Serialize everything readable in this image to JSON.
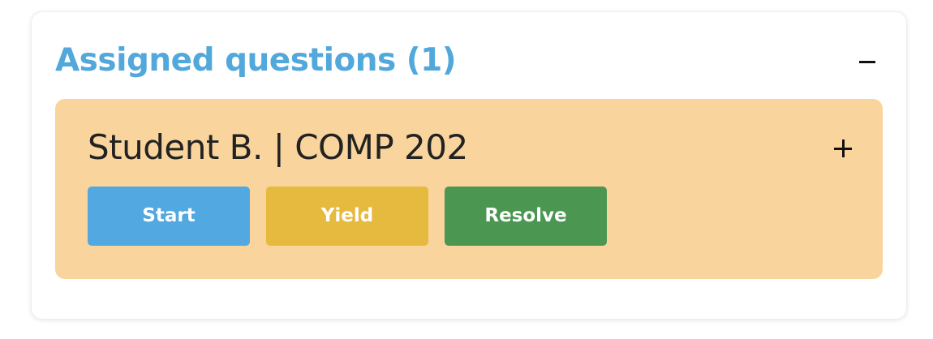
{
  "panel": {
    "title": "Assigned questions (1)",
    "collapse_icon": "minus-icon",
    "title_color": "#52a8db"
  },
  "question": {
    "title": "Student B. | COMP 202",
    "expand_icon": "plus-icon",
    "card_color": "#f9d49d",
    "actions": [
      {
        "label": "Start",
        "color": "#52a8e0"
      },
      {
        "label": "Yield",
        "color": "#e6b93f"
      },
      {
        "label": "Resolve",
        "color": "#4b9650"
      }
    ]
  }
}
